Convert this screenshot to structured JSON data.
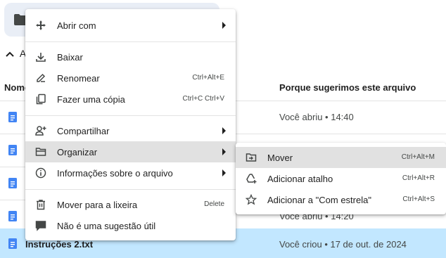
{
  "page": {
    "section_initial": "A",
    "column_name": "Nome",
    "column_reason": "Porque sugerimos este arquivo"
  },
  "rows": [
    {
      "reason": "Você abriu • 14:40"
    },
    {
      "reason": ""
    },
    {
      "reason": ""
    },
    {
      "reason": "Você abriu • 14:20"
    },
    {
      "name": "Instruções 2.txt",
      "reason": "Você criou • 17 de out. de 2024"
    }
  ],
  "context_menu": {
    "items": [
      {
        "label": "Abrir com",
        "icon": "open-with-icon",
        "shortcut": ""
      },
      {
        "label": "Baixar",
        "icon": "download-icon",
        "shortcut": ""
      },
      {
        "label": "Renomear",
        "icon": "rename-icon",
        "shortcut": "Ctrl+Alt+E"
      },
      {
        "label": "Fazer uma cópia",
        "icon": "copy-icon",
        "shortcut": "Ctrl+C Ctrl+V"
      },
      {
        "label": "Compartilhar",
        "icon": "share-icon",
        "shortcut": ""
      },
      {
        "label": "Organizar",
        "icon": "folder-open-icon",
        "shortcut": ""
      },
      {
        "label": "Informações sobre o arquivo",
        "icon": "info-icon",
        "shortcut": ""
      },
      {
        "label": "Mover para a lixeira",
        "icon": "trash-icon",
        "shortcut": "Delete"
      },
      {
        "label": "Não é uma sugestão útil",
        "icon": "feedback-icon",
        "shortcut": ""
      }
    ]
  },
  "submenu": {
    "items": [
      {
        "label": "Mover",
        "icon": "move-icon",
        "shortcut": "Ctrl+Alt+M"
      },
      {
        "label": "Adicionar atalho",
        "icon": "add-shortcut-icon",
        "shortcut": "Ctrl+Alt+R"
      },
      {
        "label": "Adicionar a \"Com estrela\"",
        "icon": "star-icon",
        "shortcut": "Ctrl+Alt+S"
      }
    ]
  },
  "colors": {
    "selected_row": "#c2e7ff",
    "doc_icon": "#4285f4",
    "highlight": "#e1e1e1"
  }
}
